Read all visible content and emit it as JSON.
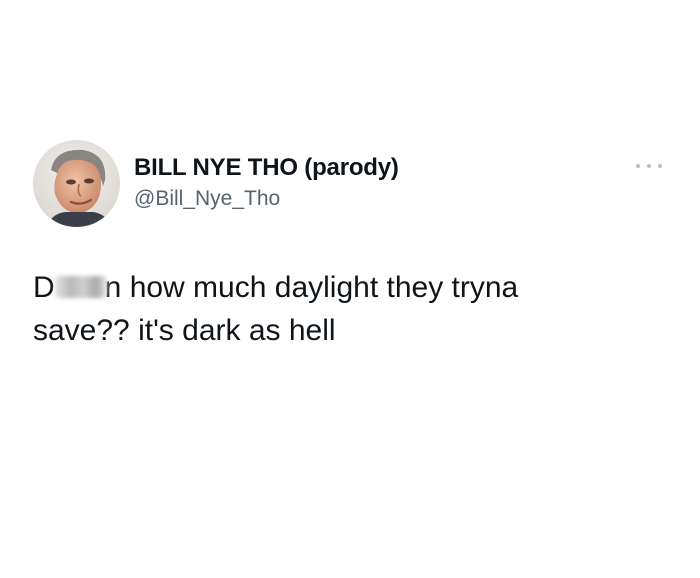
{
  "tweet": {
    "author": {
      "display_name": "BILL NYE THO (parody)",
      "handle": "@Bill_Nye_Tho",
      "avatar_icon": "profile-photo"
    },
    "more_icon": "more-horizontal-icon",
    "text": {
      "line1_start": "D",
      "line1_rest": "n how much daylight they tryna",
      "line2": "save?? it's dark as hell"
    }
  }
}
